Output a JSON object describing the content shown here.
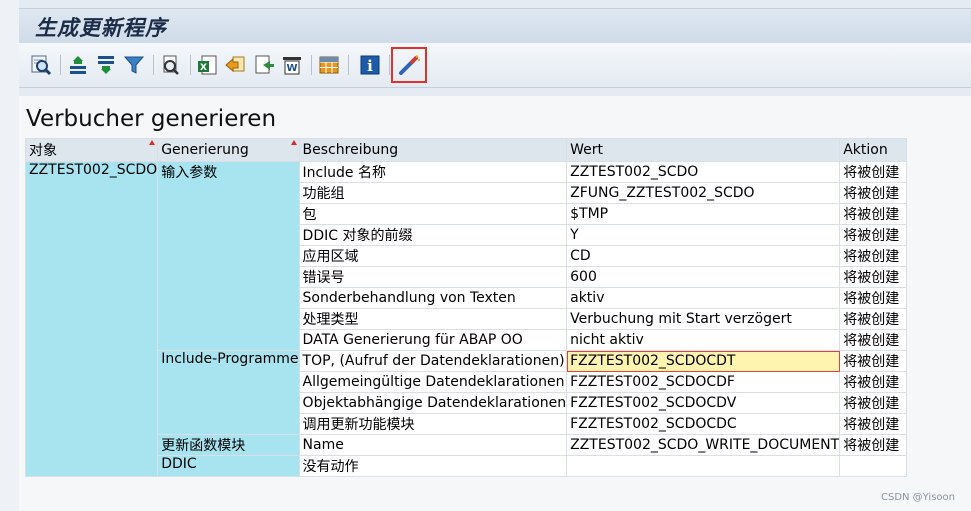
{
  "app_title": "生成更新程序",
  "toolbar": {
    "buttons": [
      {
        "name": "find-icon"
      },
      {
        "name": "sort-ascending-icon"
      },
      {
        "name": "sort-descending-icon"
      },
      {
        "name": "filter-icon"
      },
      {
        "name": "print-preview-icon"
      },
      {
        "name": "export-excel-icon"
      },
      {
        "name": "export-icon"
      },
      {
        "name": "local-file-icon"
      },
      {
        "name": "word-processing-icon"
      },
      {
        "name": "layout-icon"
      },
      {
        "name": "info-icon"
      },
      {
        "name": "generate-icon"
      }
    ]
  },
  "page_title": "Verbucher generieren",
  "table": {
    "headers": [
      "对象",
      "Generierung",
      "Beschreibung",
      "Wert",
      "Aktion"
    ],
    "object": "ZZTEST002_SCDO",
    "groups": [
      "输入参数",
      "Include-Programme",
      "更新函数模块",
      "DDIC"
    ],
    "rows": [
      {
        "desc": "Include 名称",
        "value": "ZZTEST002_SCDO",
        "action": "将被创建"
      },
      {
        "desc": "功能组",
        "value": "ZFUNG_ZZTEST002_SCDO",
        "action": "将被创建"
      },
      {
        "desc": "包",
        "value": "$TMP",
        "action": "将被创建"
      },
      {
        "desc": "DDIC 对象的前缀",
        "value": "Y",
        "action": "将被创建"
      },
      {
        "desc": "应用区域",
        "value": "CD",
        "action": "将被创建"
      },
      {
        "desc": "错误号",
        "value": "600",
        "action": "将被创建"
      },
      {
        "desc": "Sonderbehandlung von Texten",
        "value": "aktiv",
        "action": "将被创建"
      },
      {
        "desc": "处理类型",
        "value": "Verbuchung mit Start verzögert",
        "action": "将被创建"
      },
      {
        "desc": "DATA Generierung für ABAP OO",
        "value": "nicht aktiv",
        "action": "将被创建"
      },
      {
        "desc": "TOP, (Aufruf der Datendeklarationen)",
        "value": "FZZTEST002_SCDOCDT",
        "action": "将被创建"
      },
      {
        "desc": "Allgemeingültige Datendeklarationen",
        "value": "FZZTEST002_SCDOCDF",
        "action": "将被创建"
      },
      {
        "desc": "Objektabhängige Datendeklarationen",
        "value": "FZZTEST002_SCDOCDV",
        "action": "将被创建"
      },
      {
        "desc": "调用更新功能模块",
        "value": "FZZTEST002_SCDOCDC",
        "action": "将被创建"
      },
      {
        "desc": "Name",
        "value": "ZZTEST002_SCDO_WRITE_DOCUMENT",
        "action": "将被创建"
      },
      {
        "desc": "没有动作",
        "value": "",
        "action": ""
      }
    ]
  },
  "watermark": "CSDN @Yisoon",
  "colors": {
    "group_bg": "#a8e4f0",
    "header_bg": "#dde5ed",
    "selected_bg": "#fff3b0",
    "highlight": "#e0312b"
  }
}
